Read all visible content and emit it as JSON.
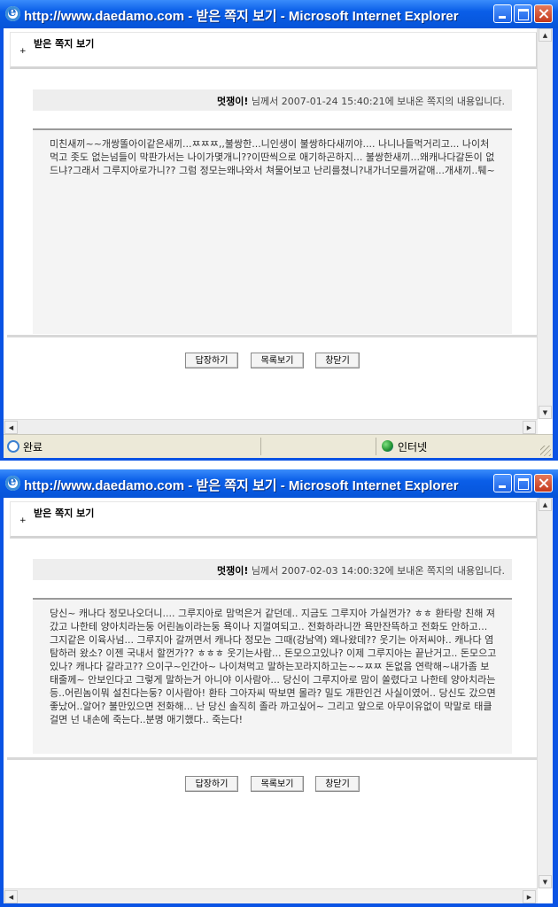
{
  "windows": [
    {
      "title": "http://www.daedamo.com - 받은 쪽지 보기 - Microsoft Internet Explorer",
      "header": {
        "label": "받은 쪽지 보기"
      },
      "info": {
        "sender": "멋쟁이!",
        "text": " 님께서 2007-01-24 15:40:21에 보내온 쪽지의 내용입니다."
      },
      "message": "미친새끼~~개쌍똘아이같은새끼...ㅉㅉㅉ,,불쌍한...니인생이 불쌍하다새끼야.... 나니나들먹거리고... 나이처먹고 좃도 없는넘들이 막판가서는 나이가몇개니??이딴씩으로 애기하곤하지... 불쌍한새끼...왜캐나다갈돈이 없드냐?그래서 그루지아로가니?? 그럼 정모는왜나와서 쳐물어보고 난리를쳤니?내가너모를꺼같애...개새끼..퉤~",
      "buttons": {
        "reply": "답장하기",
        "list": "목록보기",
        "close": "창닫기"
      },
      "status": {
        "left": "완료",
        "zone": "인터넷"
      }
    },
    {
      "title": "http://www.daedamo.com - 받은 쪽지 보기 - Microsoft Internet Explorer",
      "header": {
        "label": "받은 쪽지 보기"
      },
      "info": {
        "sender": "멋쟁이!",
        "text": " 님께서 2007-02-03 14:00:32에 보내온 쪽지의 내용입니다."
      },
      "message": "당신~ 캐나다 정모나오더니.... 그루지아로 맘먹은거 같던데.. 지금도 그루지아 가실껀가? ㅎㅎ 환타랑 친해 져갔고 나한테 양아치라는둥 어린놈이라는둥 욕이나 지껄여되고.. 전화하라니깐 욕만잔뜩하고 전화도 안하고... 그지같은 이육사넘... 그루지아 갈꺼면서 캐나다 정모는 그때(강남역) 왜나왔데?? 웃기는 아저씨야.. 캐나다 염탐하러 왔소? 이젠 국내서 할껀가?? ㅎㅎㅎ 웃기는사람... 돈모으고있나? 이제 그루지아는 끝난거고.. 돈모으고있나? 캐나다 갈라고?? 으이구~인간아~ 나이쳐먹고 말하는꼬라지하고는~~ㅉㅉ 돈없음 연락해~내가좀 보태줄께~ 안보인다고 그렇게 말하는거 아니야 이사람아... 당신이 그루지아로 맘이 쏠렸다고 나한테 양아치라는등..어린놈이뭐 설친다는둥? 이사람아! 환타 그아자씨 딱보면 몰라? 밀도 개판인건 사실이였어.. 당신도 갔으면 좋났어..알어? 불만있으면 전화해... 난 당신 솔직히 졸라 까고싶어~ 그리고 앞으로 아무이유없이 막말로 태클걸면 넌 내손에 죽는다..분명 애기했다.. 죽는다!",
      "buttons": {
        "reply": "답장하기",
        "list": "목록보기",
        "close": "창닫기"
      }
    }
  ]
}
